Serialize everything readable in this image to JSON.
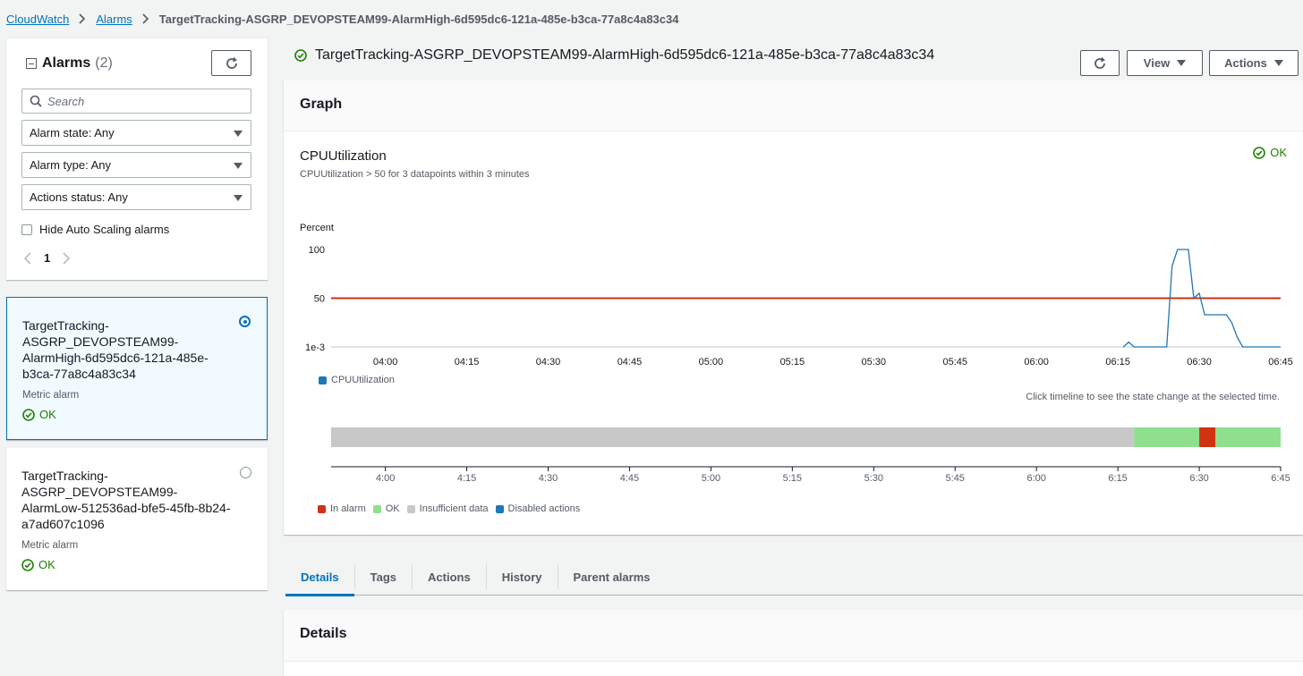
{
  "breadcrumb": {
    "items": [
      "CloudWatch",
      "Alarms"
    ],
    "current": "TargetTracking-ASGRP_DEVOPSTEAM99-AlarmHigh-6d595dc6-121a-485e-b3ca-77a8c4a83c34"
  },
  "sidebar": {
    "title": "Alarms",
    "count": "(2)",
    "search_placeholder": "Search",
    "filters": [
      "Alarm state: Any",
      "Alarm type: Any",
      "Actions status: Any"
    ],
    "hide_autoscaling_label": "Hide Auto Scaling alarms",
    "page": "1",
    "alarms": [
      {
        "name": "TargetTracking-ASGRP_DEVOPSTEAM99-AlarmHigh-6d595dc6-121a-485e-b3ca-77a8c4a83c34",
        "type": "Metric alarm",
        "state": "OK",
        "selected": true
      },
      {
        "name": "TargetTracking-ASGRP_DEVOPSTEAM99-AlarmLow-512536ad-bfe5-45fb-8b24-a7ad607c1096",
        "type": "Metric alarm",
        "state": "OK",
        "selected": false
      }
    ]
  },
  "detail": {
    "title": "TargetTracking-ASGRP_DEVOPSTEAM99-AlarmHigh-6d595dc6-121a-485e-b3ca-77a8c4a83c34",
    "view_label": "View",
    "actions_label": "Actions"
  },
  "graph": {
    "section_title": "Graph",
    "metric_name": "CPUUtilization",
    "condition": "CPUUtilization > 50 for 3 datapoints within 3 minutes",
    "state": "OK",
    "timeline_hint": "Click timeline to see the state change at the selected time.",
    "timeline_legend": [
      "In alarm",
      "OK",
      "Insufficient data",
      "Disabled actions"
    ]
  },
  "chart_data": {
    "type": "line",
    "ylabel": "Percent",
    "y_ticks": [
      "100",
      "50",
      "1e-3"
    ],
    "x_ticks": [
      "04:00",
      "04:15",
      "04:30",
      "04:45",
      "05:00",
      "05:15",
      "05:30",
      "05:45",
      "06:00",
      "06:15",
      "06:30",
      "06:45"
    ],
    "threshold": 50,
    "series": [
      {
        "name": "CPUUtilization",
        "x": [
          "06:16",
          "06:17",
          "06:18",
          "06:19",
          "06:20",
          "06:21",
          "06:22",
          "06:23",
          "06:24",
          "06:25",
          "06:26",
          "06:27",
          "06:28",
          "06:29",
          "06:30",
          "06:31",
          "06:32",
          "06:33",
          "06:34",
          "06:35",
          "06:36",
          "06:37",
          "06:38",
          "06:39",
          "06:40",
          "06:41",
          "06:42",
          "06:43",
          "06:44",
          "06:45"
        ],
        "values": [
          0.001,
          5,
          0.001,
          0.001,
          0.001,
          0.001,
          0.001,
          0.001,
          0.001,
          83,
          100,
          100,
          100,
          50,
          55,
          33,
          33,
          33,
          33,
          33,
          25,
          10,
          0.001,
          0.001,
          0.001,
          0.001,
          0.001,
          0.001,
          0.001,
          0.001
        ]
      }
    ],
    "timeline": {
      "x_ticks": [
        "4:00",
        "4:15",
        "4:30",
        "4:45",
        "5:00",
        "5:15",
        "5:30",
        "5:45",
        "6:00",
        "6:15",
        "6:30",
        "6:45"
      ],
      "segments": [
        {
          "state": "Insufficient data",
          "start": "03:50",
          "end": "06:18"
        },
        {
          "state": "OK",
          "start": "06:18",
          "end": "06:30"
        },
        {
          "state": "In alarm",
          "start": "06:30",
          "end": "06:33"
        },
        {
          "state": "OK",
          "start": "06:33",
          "end": "06:45"
        }
      ]
    }
  },
  "tabs": [
    {
      "label": "Details",
      "active": true
    },
    {
      "label": "Tags",
      "active": false
    },
    {
      "label": "Actions",
      "active": false
    },
    {
      "label": "History",
      "active": false
    },
    {
      "label": "Parent alarms",
      "active": false
    }
  ],
  "details": {
    "title": "Details"
  },
  "colors": {
    "link": "#0073bb",
    "ok": "#1d8102",
    "line": "#1f77b4",
    "threshold": "#d13212",
    "in_alarm": "#d13212",
    "ok_band": "#90df8e",
    "insufficient": "#c8c8c8",
    "disabled": "#1f77b4"
  }
}
